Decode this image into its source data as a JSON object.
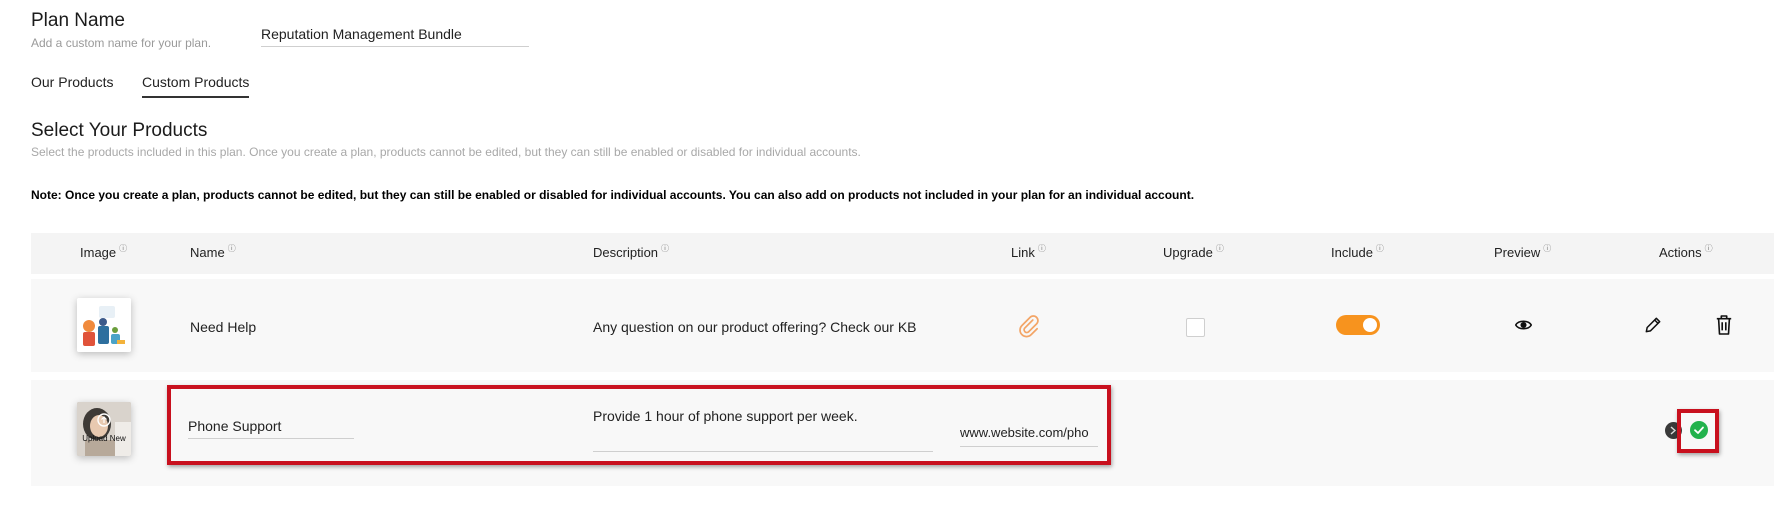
{
  "plan": {
    "title": "Plan Name",
    "subtitle": "Add a custom name for your plan.",
    "name_value": "Reputation Management Bundle"
  },
  "tabs": [
    {
      "label": "Our Products",
      "active": false
    },
    {
      "label": "Custom Products",
      "active": true
    }
  ],
  "section": {
    "title": "Select Your Products",
    "subtitle": "Select the products included in this plan. Once you create a plan, products cannot be edited, but they can still be enabled or disabled for individual accounts."
  },
  "note": "Note: Once you create a plan, products cannot be edited, but they can still be enabled or disabled for individual accounts. You can also add on products not included in your plan for an individual account.",
  "table": {
    "columns": [
      "Image",
      "Name",
      "Description",
      "Link",
      "Upgrade",
      "Include",
      "Preview",
      "Actions"
    ],
    "info_symbol": "ⓘ",
    "rows": [
      {
        "name": "Need Help",
        "description": "Any question on our product offering? Check our KB",
        "upgrade_checked": false,
        "include_enabled": true,
        "icons": [
          "link-icon",
          "eye-icon",
          "pencil-icon",
          "trash-icon"
        ]
      }
    ],
    "edit_row": {
      "upload_label": "Upload New",
      "name_value": "Phone Support",
      "description_value": "Provide 1 hour of phone support per week.",
      "link_value": "www.website.com/pho",
      "icons": [
        "cancel-icon",
        "save-check-icon"
      ]
    }
  },
  "colors": {
    "accent_orange": "#f7931e",
    "success_green": "#22b24c",
    "highlight_red": "#c8101e",
    "header_bg": "#f4f4f4",
    "row_bg": "#f8f8f8"
  }
}
